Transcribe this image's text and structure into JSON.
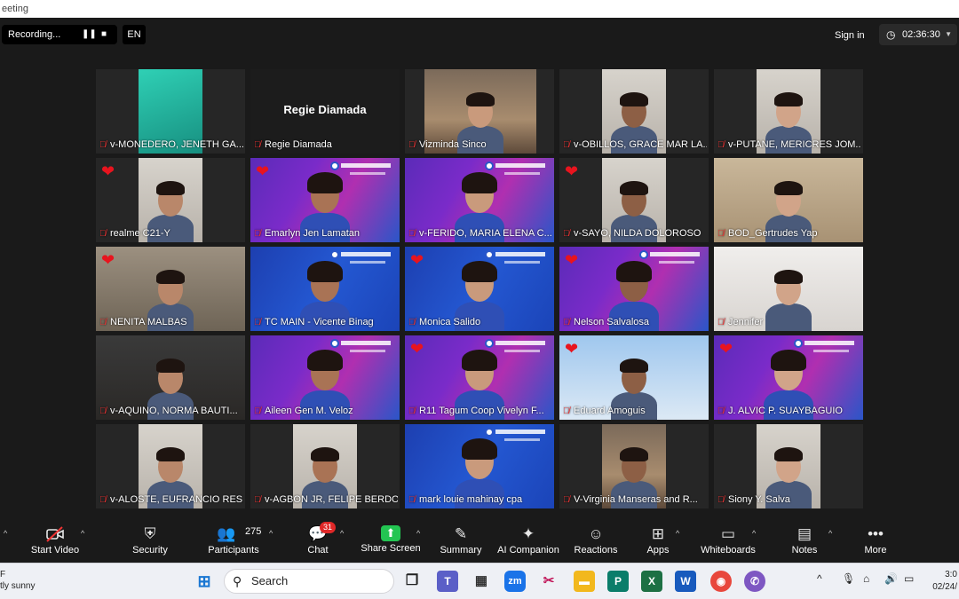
{
  "window": {
    "title_fragment": "eeting"
  },
  "topbar": {
    "recording_label": "Recording...",
    "pause_glyph": "❚❚",
    "stop_glyph": "■",
    "language": "EN",
    "signin_label": "Sign in",
    "timer": "02:36:30"
  },
  "participants": [
    {
      "name": "v-MONEDERO, JENETH GA...",
      "heart": false,
      "active": false,
      "kind": "camera-teal"
    },
    {
      "name": "Regie Diamada",
      "heart": false,
      "active": false,
      "kind": "no-video",
      "center_name": "Regie Diamada"
    },
    {
      "name": "Vizminda Sinco",
      "heart": false,
      "active": false,
      "kind": "camera-store"
    },
    {
      "name": "v-OBILLOS, GRACE MAR LA...",
      "heart": false,
      "active": false,
      "kind": "camera-room"
    },
    {
      "name": "v-PUTANE, MERICRES JOM...",
      "heart": false,
      "active": false,
      "kind": "camera-room"
    },
    {
      "name": "realme C21-Y",
      "heart": true,
      "active": false,
      "kind": "camera-room"
    },
    {
      "name": "Emarlyn Jen Lamatan",
      "heart": true,
      "active": true,
      "kind": "banner"
    },
    {
      "name": "v-FERIDO, MARIA ELENA C...",
      "heart": false,
      "active": false,
      "kind": "banner"
    },
    {
      "name": "v-SAYO, NILDA DOLOROSO",
      "heart": true,
      "active": false,
      "kind": "camera-room"
    },
    {
      "name": "BOD_Gertrudes Yap",
      "heart": false,
      "active": false,
      "kind": "camera-warm"
    },
    {
      "name": "NENITA MALBAS",
      "heart": true,
      "active": false,
      "kind": "camera-office"
    },
    {
      "name": "TC MAIN - Vicente Binag",
      "heart": false,
      "active": false,
      "kind": "banner-blue"
    },
    {
      "name": "Monica Salido",
      "heart": true,
      "active": false,
      "kind": "banner-blue"
    },
    {
      "name": "Nelson Salvalosa",
      "heart": true,
      "active": false,
      "kind": "banner"
    },
    {
      "name": "Jennifer",
      "heart": false,
      "active": false,
      "kind": "camera-white"
    },
    {
      "name": "v-AQUINO, NORMA BAUTI...",
      "heart": false,
      "active": false,
      "kind": "camera-dark"
    },
    {
      "name": "Aileen Gen M. Veloz",
      "heart": false,
      "active": false,
      "kind": "banner"
    },
    {
      "name": "R11 Tagum Coop Vivelyn F...",
      "heart": true,
      "active": false,
      "kind": "banner"
    },
    {
      "name": "Eduard Amoguis",
      "heart": true,
      "active": false,
      "kind": "camera-sky"
    },
    {
      "name": "J. ALVIC P. SUAYBAGUIO",
      "heart": true,
      "active": false,
      "kind": "banner"
    },
    {
      "name": "v-ALOSTE, EUFRANCIO RES...",
      "heart": false,
      "active": false,
      "kind": "camera-room"
    },
    {
      "name": "v-AGBON JR, FELIPE BERDOS",
      "heart": false,
      "active": false,
      "kind": "camera-room"
    },
    {
      "name": "mark louie mahinay cpa",
      "heart": false,
      "active": false,
      "kind": "banner-blue"
    },
    {
      "name": "V-Virginia Manseras and R...",
      "heart": false,
      "active": false,
      "kind": "camera-store"
    },
    {
      "name": "Siony Y. Salva",
      "heart": false,
      "active": false,
      "kind": "camera-room"
    }
  ],
  "toolbar": {
    "start_video": "Start Video",
    "security": "Security",
    "participants": "Participants",
    "participants_count": "275",
    "chat": "Chat",
    "chat_badge": "31",
    "share_screen": "Share Screen",
    "summary": "Summary",
    "ai_companion": "AI Companion",
    "reactions": "Reactions",
    "apps": "Apps",
    "whiteboards": "Whiteboards",
    "notes": "Notes",
    "more": "More"
  },
  "taskbar": {
    "weather_line1": "F",
    "weather_line2": "tly sunny",
    "search_placeholder": "Search",
    "time": "3:0",
    "date": "02/24/"
  },
  "colors": {
    "heart": "#e8141e",
    "active_border": "#d8e23c",
    "share_green": "#23c552",
    "chat_badge": "#e02828"
  }
}
